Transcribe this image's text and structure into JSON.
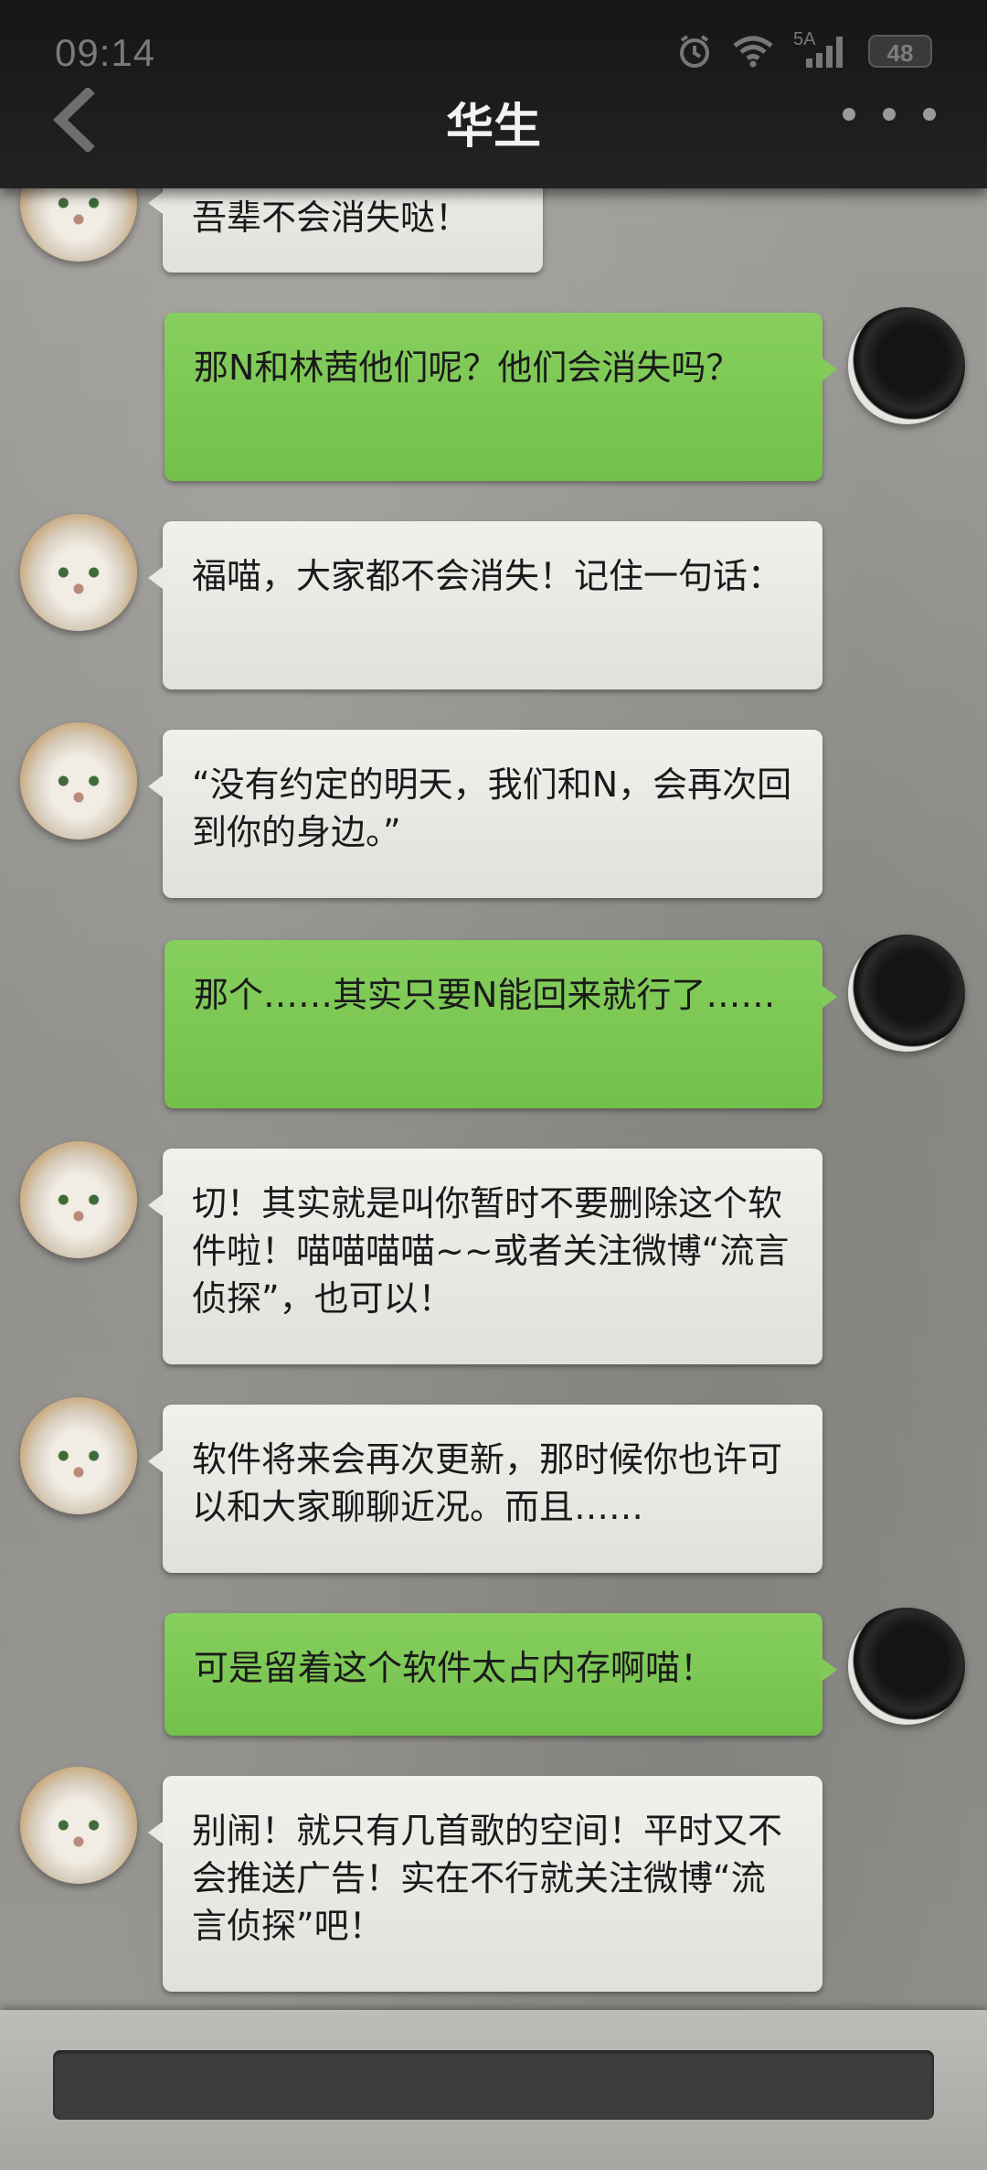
{
  "status_bar": {
    "time": "09:14",
    "network": "5A",
    "battery": "48",
    "icons": [
      "alarm-icon",
      "wifi-icon",
      "signal-icon",
      "battery-icon"
    ]
  },
  "header": {
    "title": "华生",
    "back_icon": "chevron-left-icon",
    "more_icon": "more-dots-icon"
  },
  "messages": [
    {
      "side": "left",
      "sender": "cat",
      "text": "吾辈不会消失哒！"
    },
    {
      "side": "right",
      "sender": "user",
      "text": "那N和林茜他们呢？他们会消失吗？"
    },
    {
      "side": "left",
      "sender": "cat",
      "text": "福喵，大家都不会消失！记住一句话："
    },
    {
      "side": "left",
      "sender": "cat",
      "text": "“没有约定的明天，我们和N，会再次回到你的身边。”"
    },
    {
      "side": "right",
      "sender": "user",
      "text": "那个……其实只要N能回来就行了……"
    },
    {
      "side": "left",
      "sender": "cat",
      "text": "切！其实就是叫你暂时不要删除这个软件啦！喵喵喵喵~~或者关注微博“流言侦探”，也可以！"
    },
    {
      "side": "left",
      "sender": "cat",
      "text": "软件将来会再次更新，那时候你也许可以和大家聊聊近况。而且……"
    },
    {
      "side": "right",
      "sender": "user",
      "text": "可是留着这个软件太占内存啊喵！"
    },
    {
      "side": "left",
      "sender": "cat",
      "text": "别闹！就只有几首歌的空间！平时又不会推送广告！实在不行就关注微博“流言侦探”吧！"
    }
  ],
  "input": {
    "value": "",
    "placeholder": ""
  },
  "colors": {
    "bubble_right": "#7ec856",
    "bubble_left": "#ebe9e6",
    "header_bg": "#1b1b1b"
  }
}
